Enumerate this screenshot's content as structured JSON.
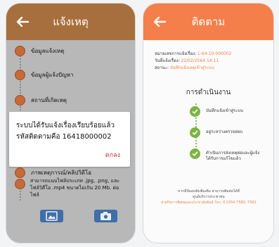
{
  "left_screen": {
    "title": "แจ้งเหตุ",
    "steps": [
      {
        "label": "ข้อมูลแจ้งเหตุ"
      },
      {
        "label": "ข้อมูลผู้แจ้งปัญหา"
      },
      {
        "label": "สถานที่เกิดเหตุ"
      }
    ],
    "dialog": {
      "message": "ระบบได้รับแจ้งเรื่องเรียบร้อยแล้ว รหัสติดตามคือ 16418000002",
      "ok_label": "ตกลง"
    },
    "photo_step_label": "ภาพเหตุการณ์/คลิปวิดีโอ",
    "upload_hint": "สามารถแนบไฟล์ประเภท .jpg, .png, และไฟล์วิดีโอ .mp4 ขนาดไม่เกิน 20 Mb. ต่อไฟล์",
    "buttons": [
      {
        "icon": "image-icon"
      },
      {
        "icon": "camera-icon"
      }
    ]
  },
  "right_screen": {
    "title": "ติดตาม",
    "info": [
      {
        "label": "หมายเลขการแจ้งเรื่อง:",
        "value": "1-64-10-000002"
      },
      {
        "label": "วันที่แจ้งเรื่อง:",
        "value": "22/02/2564 14:11"
      },
      {
        "label": "สถานะ:",
        "value": "บันทึกแจ้งเหตุเข้าสู่ระบบ"
      }
    ],
    "progress_title": "การดำเนินงาน",
    "progress_steps": [
      {
        "label": "บันทึกแจ้งเข้าสู่ระบบ"
      },
      {
        "label": "อยู่ระหว่างตรวจสอบ"
      },
      {
        "label": "ดำเนินการส่งเหตุต่อและผู้แจ้งได้รับการแก้ไขแล้ว"
      }
    ],
    "footer_line1": "หากมีข้อสงสัยเพิ่มเติม สามารถติดต่อได้ที่",
    "footer_line2": "ศูนย์บริการประชาชน",
    "footer_line3": "ฝ่ายกิจการพิเศษและประชาสัมพันธ์ โทร. 0 2354 7580, 7582"
  }
}
